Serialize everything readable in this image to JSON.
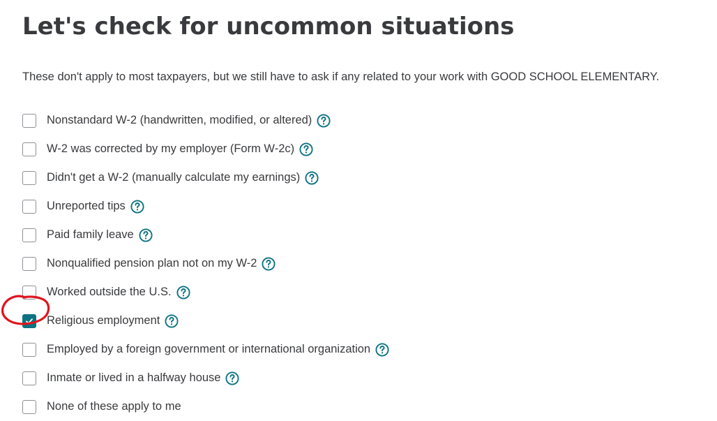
{
  "page": {
    "title": "Let's check for uncommon situations",
    "intro": "These don't apply to most taxpayers, but we still have to ask if any related to your work with GOOD SCHOOL ELEMENTARY."
  },
  "colors": {
    "accent": "#0d7382",
    "text": "#393a3d",
    "checkbox_border": "#8d9096",
    "annotation_red": "#e0141e"
  },
  "options": [
    {
      "label": "Nonstandard W-2 (handwritten, modified, or altered)",
      "checked": false,
      "help_icon": "question-circle-icon"
    },
    {
      "label": "W-2 was corrected by my employer (Form W-2c)",
      "checked": false,
      "help_icon": "question-circle-icon"
    },
    {
      "label": "Didn't get a W-2 (manually calculate my earnings)",
      "checked": false,
      "help_icon": "question-circle-icon"
    },
    {
      "label": "Unreported tips",
      "checked": false,
      "help_icon": "question-circle-icon"
    },
    {
      "label": "Paid family leave",
      "checked": false,
      "help_icon": "question-circle-icon"
    },
    {
      "label": "Nonqualified pension plan not on my W-2",
      "checked": false,
      "help_icon": "question-circle-icon"
    },
    {
      "label": "Worked outside the U.S.",
      "checked": false,
      "help_icon": "question-circle-icon"
    },
    {
      "label": "Religious employment",
      "checked": true,
      "help_icon": "question-circle-icon"
    },
    {
      "label": "Employed by a foreign government or international organization",
      "checked": false,
      "help_icon": "question-circle-icon"
    },
    {
      "label": "Inmate or lived in a halfway house",
      "checked": false,
      "help_icon": "question-circle-icon"
    },
    {
      "label": "None of these apply to me",
      "checked": false,
      "help_icon": null
    }
  ]
}
